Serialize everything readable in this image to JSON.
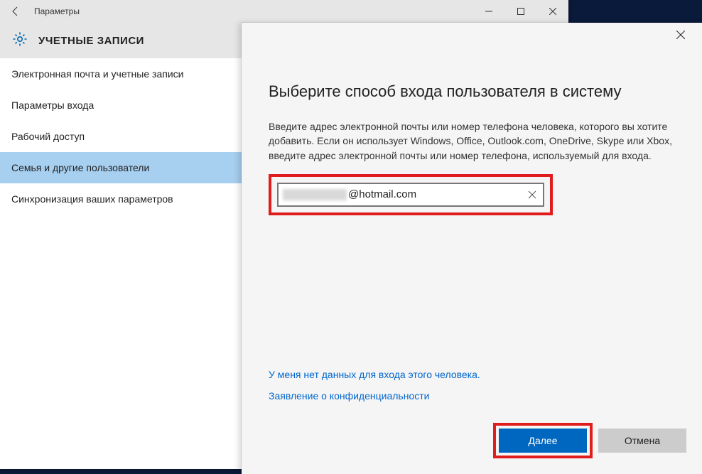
{
  "settings": {
    "window_title": "Параметры",
    "header_title": "УЧЕТНЫЕ ЗАПИСИ",
    "nav": [
      {
        "label": "Электронная почта и учетные записи"
      },
      {
        "label": "Параметры входа"
      },
      {
        "label": "Рабочий доступ"
      },
      {
        "label": "Семья и другие пользователи",
        "selected": true
      },
      {
        "label": "Синхронизация ваших параметров"
      }
    ]
  },
  "dialog": {
    "title": "Выберите способ входа пользователя в систему",
    "description": "Введите адрес электронной почты или номер телефона человека, которого вы хотите добавить. Если он использует Windows, Office, Outlook.com, OneDrive, Skype или Xbox, введите адрес электронной почты или номер телефона, используемый для входа.",
    "email_value": "@hotmail.com",
    "link_no_info": "У меня нет данных для входа этого человека.",
    "link_privacy": "Заявление о конфиденциальности",
    "btn_next": "Далее",
    "btn_cancel": "Отмена"
  }
}
